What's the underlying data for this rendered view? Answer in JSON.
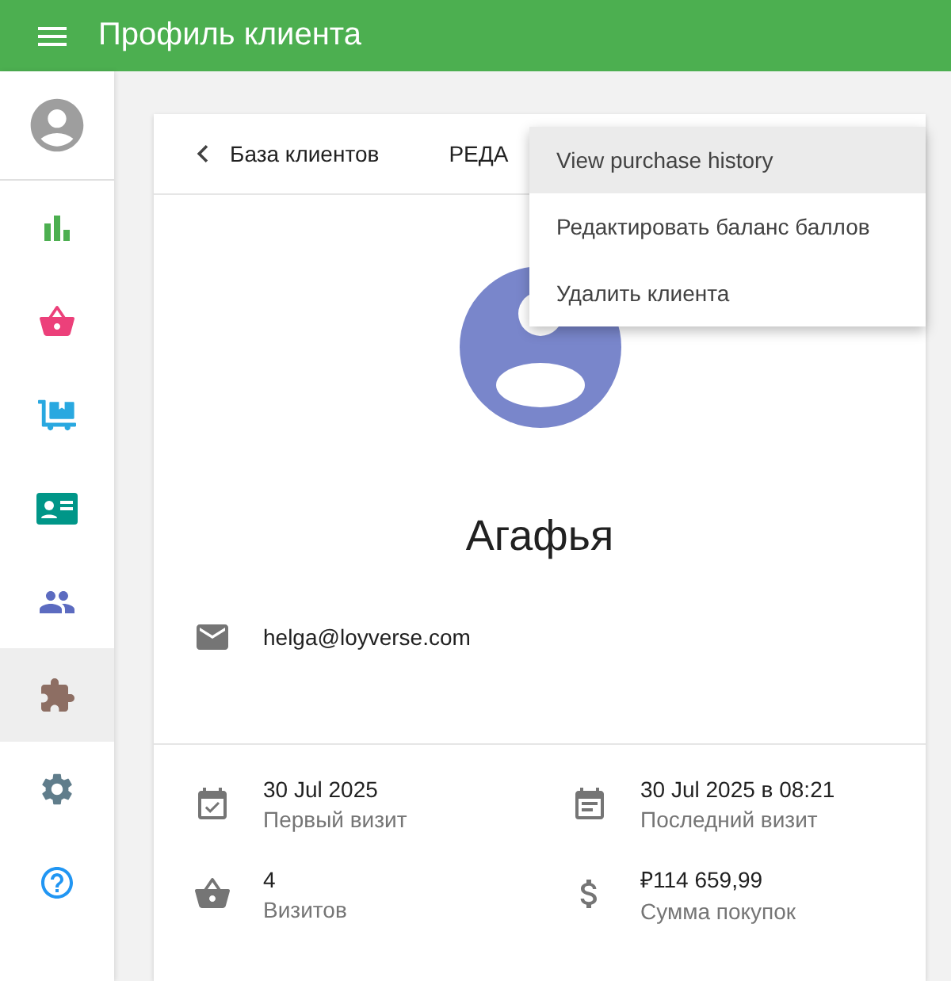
{
  "app_bar": {
    "title": "Профиль клиента"
  },
  "sidebar": {
    "items": [
      {
        "selected": false
      },
      {
        "selected": false
      },
      {
        "selected": false
      },
      {
        "selected": false
      },
      {
        "selected": false
      },
      {
        "selected": true
      },
      {
        "selected": false
      },
      {
        "selected": false
      }
    ]
  },
  "card": {
    "back_link": "База клиентов",
    "edit_button": "РЕДА",
    "name": "Агафья",
    "email": "helga@loyverse.com",
    "stats": [
      {
        "value": "30 Jul 2025",
        "label": "Первый визит"
      },
      {
        "value": "30 Jul 2025 в 08:21",
        "label": "Последний визит"
      },
      {
        "value": "4",
        "label": "Визитов"
      },
      {
        "value": "₽114 659,99",
        "label": "Сумма покупок"
      }
    ]
  },
  "menu": {
    "items": [
      {
        "label": "View purchase history",
        "selected": true
      },
      {
        "label": "Редактировать баланс баллов",
        "selected": false
      },
      {
        "label": "Удалить клиента",
        "selected": false
      }
    ]
  }
}
